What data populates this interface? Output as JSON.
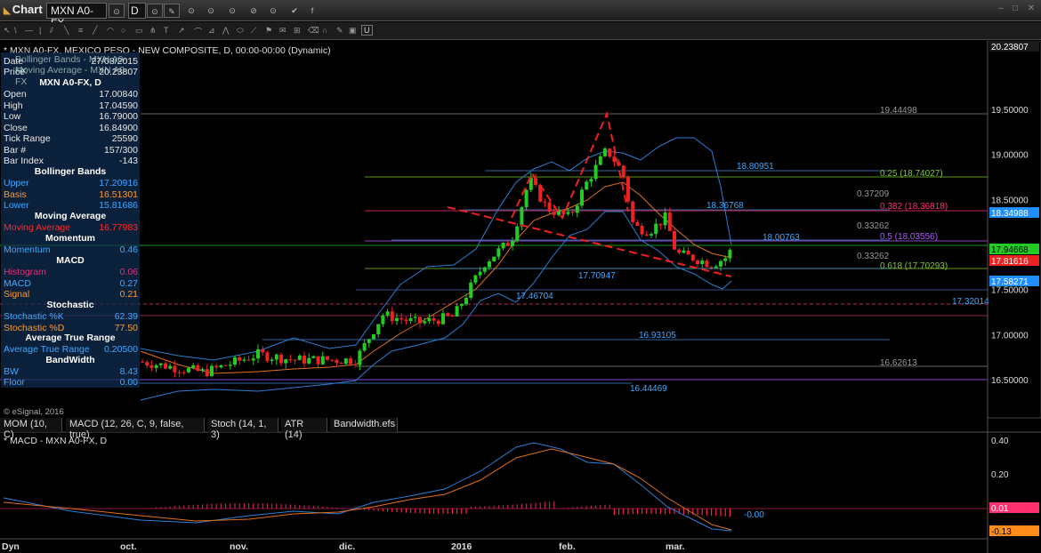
{
  "toolbar": {
    "app_title": "Chart",
    "symbol": "MXN A0-FX",
    "interval": "D",
    "interval_arrow": "▾"
  },
  "chart": {
    "header": "* MXN A0-FX, MEXICO PESO - NEW COMPOSITE, D, 00:00-00:00 (Dynamic)",
    "study_line1": "Bollinger Bands - MXN A0-FX",
    "study_line2": "Moving Average - MXN A0-FX",
    "watermark": "© eSignal, 2016",
    "price_axis": [
      "19.50000",
      "19.00000",
      "18.50000",
      "17.50000",
      "17.00000",
      "16.50000"
    ],
    "price_badges": {
      "top": "20.23807",
      "b1": "18.34988",
      "b2": "17.94668",
      "b3": "17.81616",
      "b4": "17.58271",
      "b5": "17.32014"
    },
    "fib_labels": [
      "19.44498",
      "18.80951",
      "0.25 (18.74027)",
      "0.37209",
      "18.36768",
      "0.382 (18.36818)",
      "0.33262",
      "18.00763",
      "0.5 (18.03556)",
      "0.33262",
      "0.618 (17.70293)",
      "17.70947",
      "17.46704",
      "16.93105",
      "16.62613",
      "16.44469"
    ],
    "time_axis": [
      "Dyn",
      "oct.",
      "nov.",
      "dic.",
      "2016",
      "feb.",
      "mar."
    ]
  },
  "data_window": {
    "date_label": "Date",
    "date_value": "27/08/2015",
    "price_label": "Price",
    "price_value": "20.23807",
    "symbol_head": "MXN A0-FX, D",
    "rows": [
      {
        "k": "Open",
        "v": "17.00840"
      },
      {
        "k": "High",
        "v": "17.04590"
      },
      {
        "k": "Low",
        "v": "16.79000"
      },
      {
        "k": "Close",
        "v": "16.84900"
      },
      {
        "k": "Tick Range",
        "v": "25590"
      },
      {
        "k": "Bar #",
        "v": "157/300"
      },
      {
        "k": "Bar Index",
        "v": "-143"
      }
    ],
    "bb_head": "Bollinger Bands",
    "bb": [
      {
        "k": "Upper",
        "v": "17.20916"
      },
      {
        "k": "Basis",
        "v": "16.51301"
      },
      {
        "k": "Lower",
        "v": "15.81686"
      }
    ],
    "ma_head": "Moving Average",
    "ma": {
      "k": "Moving Average",
      "v": "16.77983"
    },
    "mom_head": "Momentum",
    "mom": {
      "k": "Momentum",
      "v": "0.46"
    },
    "macd_head": "MACD",
    "macd": [
      {
        "k": "Histogram",
        "v": "0.06"
      },
      {
        "k": "MACD",
        "v": "0.27"
      },
      {
        "k": "Signal",
        "v": "0.21"
      }
    ],
    "sto_head": "Stochastic",
    "sto": [
      {
        "k": "Stochastic %K",
        "v": "62.39"
      },
      {
        "k": "Stochastic %D",
        "v": "77.50"
      }
    ],
    "atr_head": "Average True Range",
    "atr": {
      "k": "Average True Range",
      "v": "0.20500"
    },
    "bw_head": "BandWidth",
    "bw": [
      {
        "k": "BW",
        "v": "8.43"
      },
      {
        "k": "Floor",
        "v": "0.00"
      }
    ]
  },
  "study_tabs": [
    "MOM (10, C)",
    "MACD (12, 26, C, 9, false, true)",
    "Stoch (14, 1, 3)",
    "ATR (14)",
    "Bandwidth.efs"
  ],
  "macd_pane": {
    "title": "* MACD - MXN A0-FX, D",
    "axis": [
      "0.40",
      "0.20"
    ],
    "zero_label": "-0.00",
    "badge_signal": "0.01",
    "badge_hist": "-0.13"
  },
  "colors": {
    "up": "#22cc22",
    "down": "#ee2222",
    "bollinger": "#2a7fd4",
    "ma": "#e0701a",
    "fib_green": "#7ec832",
    "fib_purple": "#b05cff",
    "fib_red": "#ff3070",
    "badge_blue": "#1f8fff"
  }
}
